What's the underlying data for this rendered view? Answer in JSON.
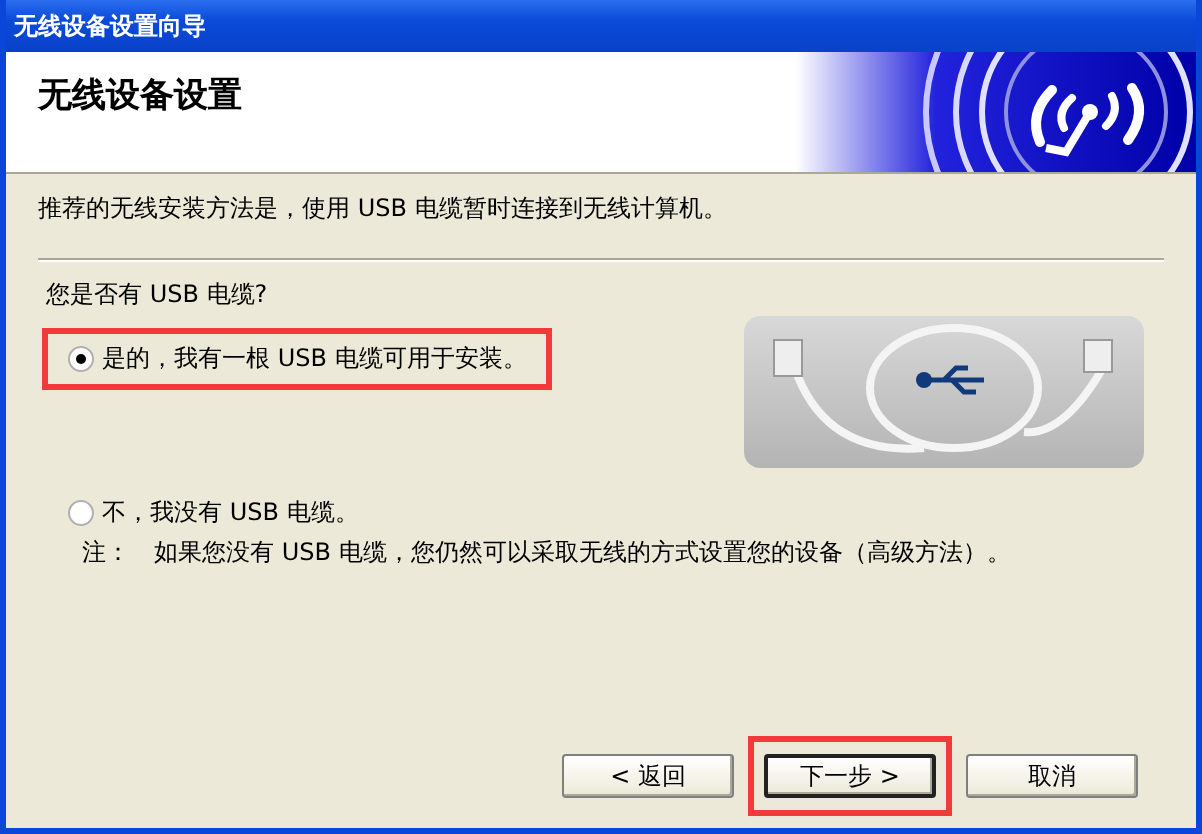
{
  "window": {
    "title": "无线设备设置向导"
  },
  "header": {
    "title": "无线设备设置"
  },
  "intro": "推荐的无线安装方法是，使用 USB 电缆暂时连接到无线计算机。",
  "question": "您是否有 USB 电缆?",
  "options": [
    {
      "label": "是的，我有一根 USB 电缆可用于安装。",
      "selected": true,
      "highlighted": true
    },
    {
      "label": "不，我没有 USB 电缆。",
      "selected": false,
      "highlighted": false
    }
  ],
  "note": {
    "label": "注：",
    "text": "如果您没有 USB 电缆，您仍然可以采取无线的方式设置您的设备（高级方法）。"
  },
  "buttons": [
    {
      "label": "< 返回",
      "default": false,
      "highlighted": false
    },
    {
      "label": "下一步 >",
      "default": true,
      "highlighted": true
    },
    {
      "label": "取消",
      "default": false,
      "highlighted": false
    }
  ]
}
